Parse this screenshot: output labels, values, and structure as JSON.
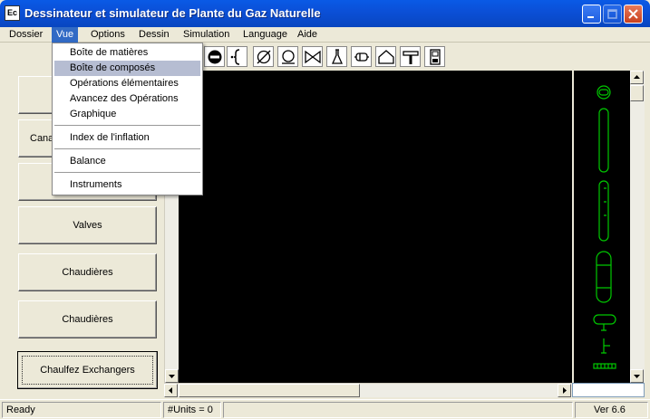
{
  "window": {
    "title": "Dessinateur et simulateur de Plante du Gaz Naturelle",
    "icon_label": "Ec"
  },
  "menubar": {
    "items": [
      {
        "label": "Dossier"
      },
      {
        "label": "Vue",
        "open": true
      },
      {
        "label": "Options"
      },
      {
        "label": "Dessin"
      },
      {
        "label": "Simulation"
      },
      {
        "label": "Language"
      },
      {
        "label": "Aide"
      }
    ]
  },
  "vue_menu": {
    "items": [
      {
        "label": "Boîte de matières"
      },
      {
        "label": "Boîte de composés",
        "highlighted": true
      },
      {
        "label": "Opérations élémentaires"
      },
      {
        "label": "Avancez des Opérations"
      },
      {
        "label": "Graphique"
      },
      {
        "label": "Index de l'inflation"
      },
      {
        "label": "Balance"
      },
      {
        "label": "Instruments"
      }
    ]
  },
  "toolbar": {
    "tools": [
      "stop-sign-icon",
      "curly-bracket-icon",
      "diameter-icon",
      "pump-icon",
      "valve-icon",
      "flask-icon",
      "pipe-section-icon",
      "house-icon",
      "hammer-icon",
      "device-icon"
    ]
  },
  "side_panel": {
    "buttons": [
      {
        "label": ""
      },
      {
        "label": "Cana"
      },
      {
        "label": ""
      },
      {
        "label": "Valves"
      },
      {
        "label": "Chaudières"
      },
      {
        "label": "Chaudières"
      },
      {
        "label": "Chaulfez Exchangers",
        "focused": true
      }
    ]
  },
  "status": {
    "state": "Ready",
    "units": "#Units = 0",
    "version": "Ver 6.6"
  },
  "colors": {
    "title_bar": "#0b4fd6",
    "menu_highlight": "#316ac5",
    "canvas": "#000000",
    "palette_shapes": "#00c800"
  }
}
